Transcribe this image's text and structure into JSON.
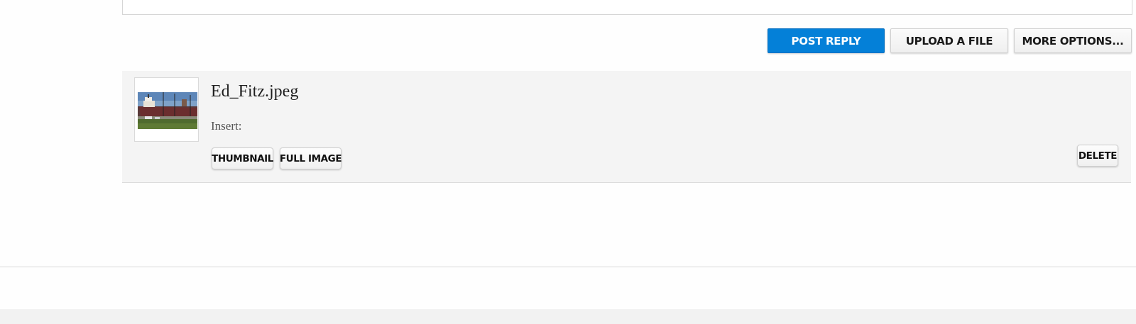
{
  "buttons": {
    "post_reply": "POST REPLY",
    "upload_file": "UPLOAD A FILE",
    "more_options": "MORE OPTIONS..."
  },
  "attachment": {
    "file_name": "Ed_Fitz.jpeg",
    "insert_label": "Insert:",
    "thumbnail_button": "THUMBNAIL",
    "full_image_button": "FULL IMAGE",
    "delete_button": "DELETE"
  },
  "colors": {
    "primary": "#0480d8",
    "attachment_bg": "#f4f4f4"
  }
}
